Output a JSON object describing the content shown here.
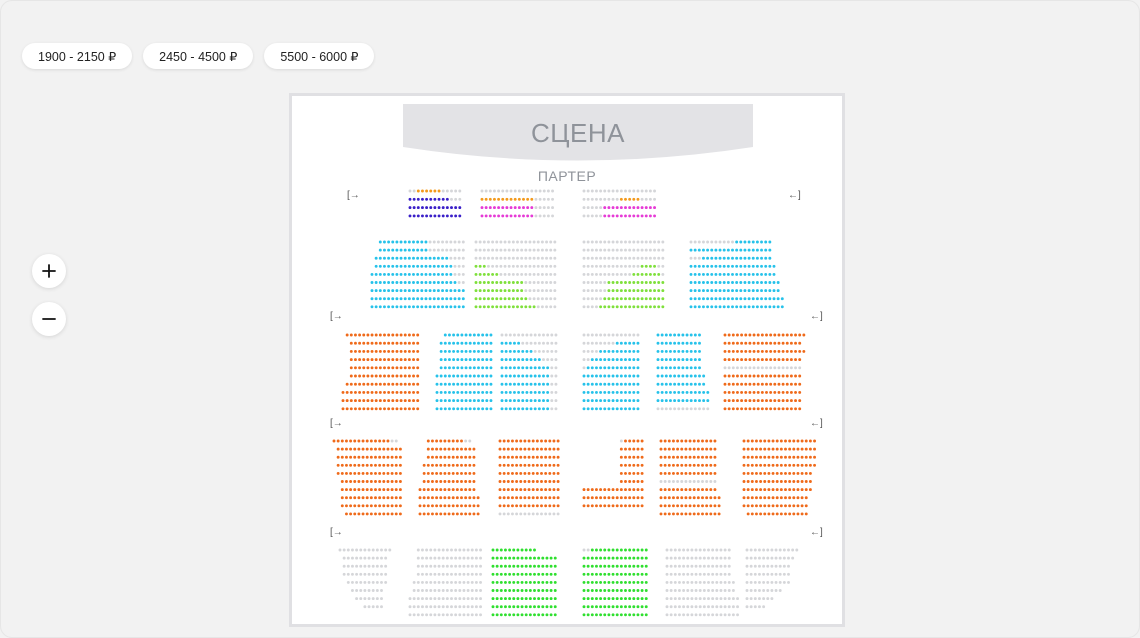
{
  "filters": [
    {
      "label": "1900 - 2150 ₽"
    },
    {
      "label": "2450 - 4500 ₽"
    },
    {
      "label": "5500 - 6000 ₽"
    }
  ],
  "zoom": {
    "in_label": "+",
    "out_label": "−"
  },
  "hall": {
    "stage_label": "СЦЕНА",
    "section_label": "ПАРТЕР"
  },
  "colors": {
    "background": "#f2f2f2",
    "unavailable": "#d5d6d9",
    "orange": "#f39a1c",
    "violet": "#3a1fc8",
    "magenta": "#e63bd6",
    "cyan": "#26c2ea",
    "lime": "#7fe03b",
    "red_orange": "#ef6a1a",
    "green": "#2fdf2f"
  },
  "exits": [
    {
      "glyph": "[→"
    },
    {
      "glyph": "←]"
    },
    {
      "glyph": "[→"
    },
    {
      "glyph": "←]"
    },
    {
      "glyph": "[→"
    },
    {
      "glyph": "←]"
    },
    {
      "glyph": "[→"
    },
    {
      "glyph": "←]"
    }
  ]
}
